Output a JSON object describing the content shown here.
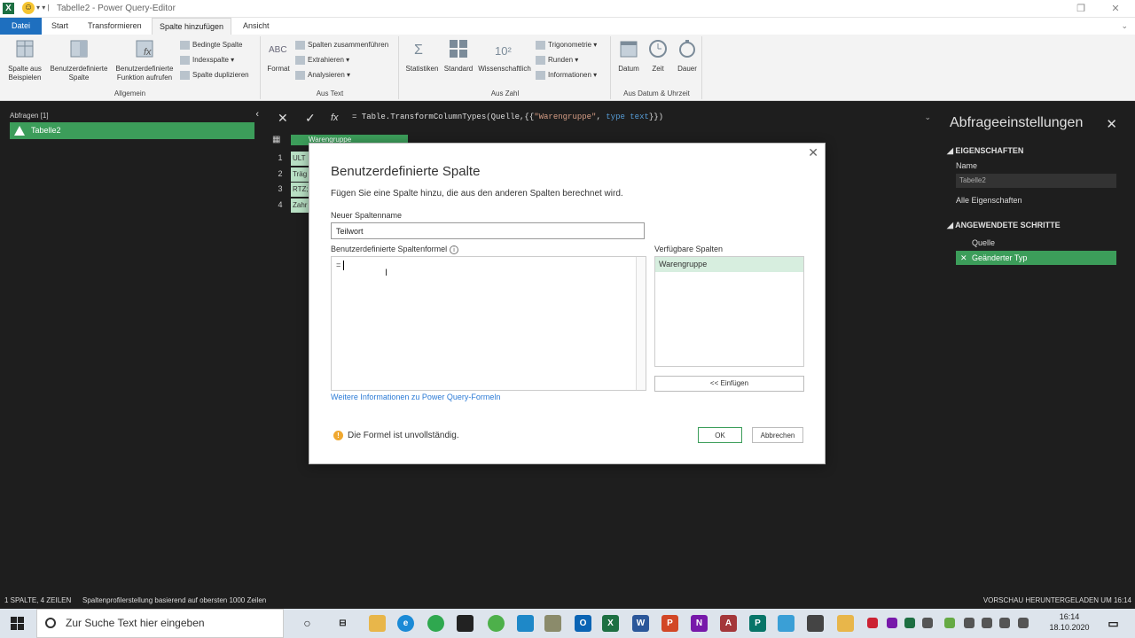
{
  "window": {
    "title": "Tabelle2 - Power Query-Editor",
    "app_icon": "X"
  },
  "ribbon_tabs": [
    "Datei",
    "Start",
    "Transformieren",
    "Spalte hinzufügen",
    "Ansicht"
  ],
  "ribbon": {
    "groups": {
      "allgemein": {
        "label": "Allgemein",
        "btn1": "Spalte aus Beispielen",
        "btn2": "Benutzerdefinierte Spalte",
        "btn3": "Benutzerdefinierte Funktion aufrufen",
        "small1": "Bedingte Spalte",
        "small2": "Indexspalte",
        "small3": "Spalte duplizieren"
      },
      "aus_text": {
        "label": "Aus Text",
        "btn1": "Format",
        "small1": "Spalten zusammenführen",
        "small2": "Extrahieren",
        "small3": "Analysieren"
      },
      "aus_zahl": {
        "label": "Aus Zahl",
        "btn1": "Statistiken",
        "btn2": "Standard",
        "btn3": "Wissenschaftlich",
        "small1": "Trigonometrie",
        "small2": "Runden",
        "small3": "Informationen"
      },
      "aus_datum": {
        "label": "Aus Datum & Uhrzeit",
        "btn1": "Datum",
        "btn2": "Zeit",
        "btn3": "Dauer"
      }
    }
  },
  "queries": {
    "header": "Abfragen [1]",
    "items": [
      "Tabelle2"
    ]
  },
  "formula_bar": {
    "prefix": "= Table.TransformColumnTypes(Quelle,{{",
    "str": "\"Warengruppe\"",
    "mid": ", ",
    "kw": "type text",
    "suffix": "}})"
  },
  "grid": {
    "column": "Warengruppe",
    "rows": [
      {
        "num": "1",
        "value": "ULT"
      },
      {
        "num": "2",
        "value": "Träg"
      },
      {
        "num": "3",
        "value": "RTZ;"
      },
      {
        "num": "4",
        "value": "Zahr"
      }
    ]
  },
  "settings": {
    "title": "Abfrageeinstellungen",
    "props_header": "EIGENSCHAFTEN",
    "name_label": "Name",
    "name_value": "Tabelle2",
    "all_props": "Alle Eigenschaften",
    "steps_header": "ANGEWENDETE SCHRITTE",
    "steps": [
      "Quelle",
      "Geänderter Typ"
    ]
  },
  "status": {
    "left": "1 SPALTE, 4 ZEILEN",
    "profile": "Spaltenprofilerstellung basierend auf obersten 1000 Zeilen",
    "right": "VORSCHAU HERUNTERGELADEN UM 16:14"
  },
  "dialog": {
    "title": "Benutzerdefinierte Spalte",
    "subtitle": "Fügen Sie eine Spalte hinzu, die aus den anderen Spalten berechnet wird.",
    "name_label": "Neuer Spaltenname",
    "name_value": "Teilwort",
    "formula_label": "Benutzerdefinierte Spaltenformel",
    "formula_value": "=",
    "available_label": "Verfügbare Spalten",
    "available_columns": [
      "Warengruppe"
    ],
    "insert_button": "<< Einfügen",
    "more_link": "Weitere Informationen zu Power Query-Formeln",
    "warning": "Die Formel ist unvollständig.",
    "ok": "OK",
    "cancel": "Abbrechen"
  },
  "taskbar": {
    "search_placeholder": "Zur Suche Text hier eingeben",
    "time": "16:14",
    "date": "18.10.2020"
  },
  "colors": {
    "accent_green": "#3c9d5a",
    "file_tab_blue": "#1e6fbf",
    "dark_bg": "#1e1e1e"
  }
}
